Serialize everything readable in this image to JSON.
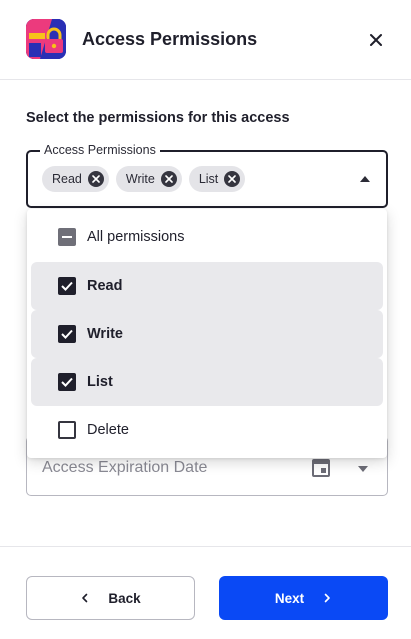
{
  "header": {
    "title": "Access Permissions",
    "app_icon": "padlock-app-icon",
    "close_icon": "close-icon"
  },
  "section_label": "Select the permissions for this access",
  "permissions_select": {
    "legend": "Access Permissions",
    "chips": [
      {
        "label": "Read"
      },
      {
        "label": "Write"
      },
      {
        "label": "List"
      }
    ],
    "caret_icon": "caret-up-icon"
  },
  "dropdown": {
    "options": [
      {
        "label": "All permissions",
        "state": "indeterminate"
      },
      {
        "label": "Read",
        "state": "checked"
      },
      {
        "label": "Write",
        "state": "checked"
      },
      {
        "label": "List",
        "state": "checked"
      },
      {
        "label": "Delete",
        "state": "unchecked"
      }
    ]
  },
  "expiration": {
    "placeholder": "Access Expiration Date",
    "calendar_icon": "calendar-icon",
    "caret_icon": "caret-down-icon"
  },
  "footer": {
    "back_label": "Back",
    "next_label": "Next"
  },
  "colors": {
    "primary": "#0a49f5",
    "text": "#1f1f2b",
    "selected_bg": "#e9e9ec",
    "chip_bg": "#e4e4e8"
  }
}
